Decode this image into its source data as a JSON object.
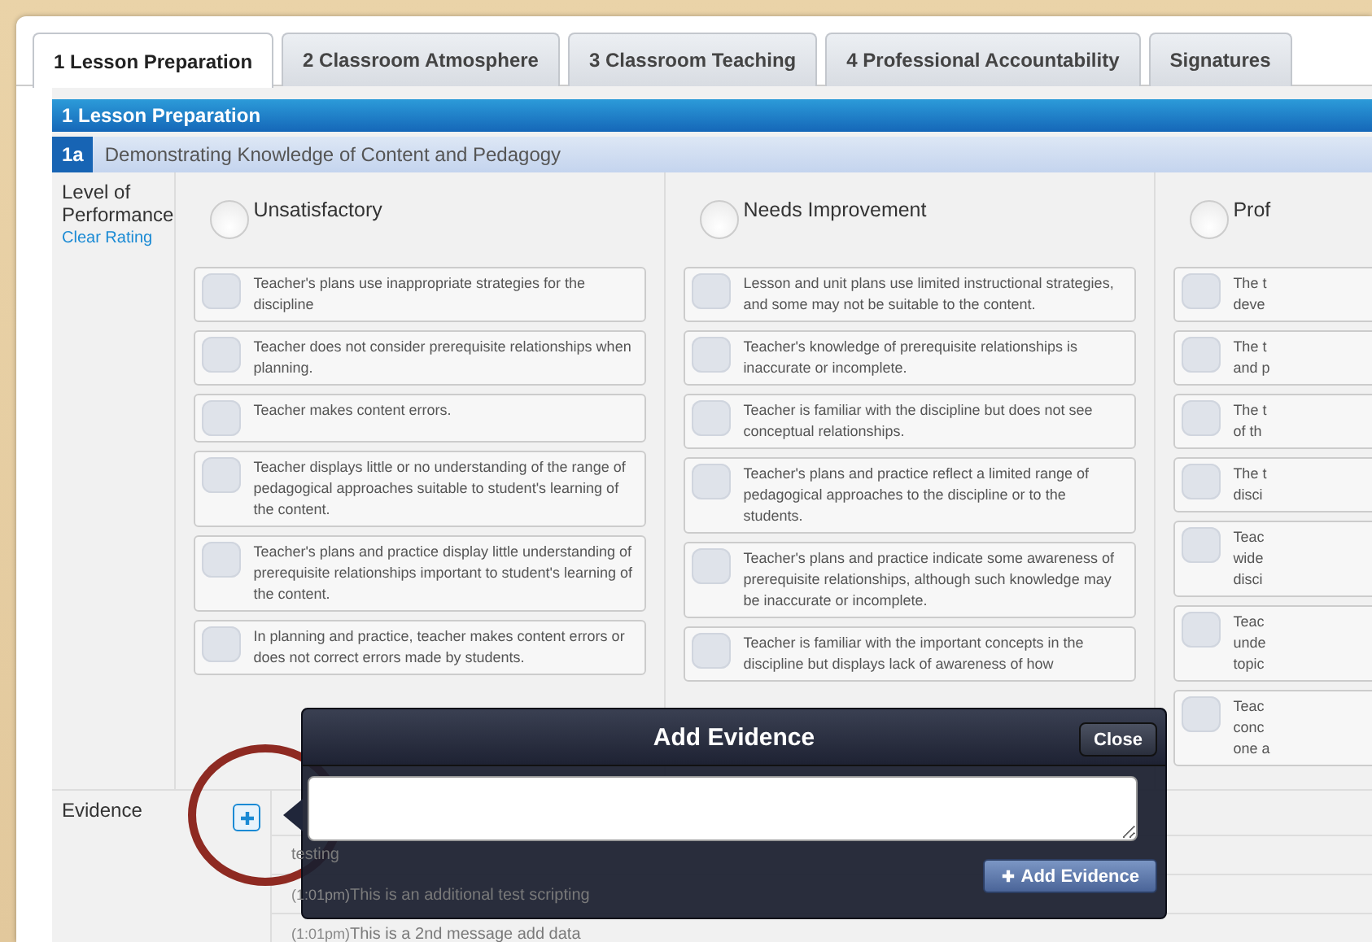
{
  "tabs": [
    {
      "label": "1 Lesson Preparation",
      "selected": true
    },
    {
      "label": "2 Classroom Atmosphere",
      "selected": false
    },
    {
      "label": "3 Classroom Teaching",
      "selected": false
    },
    {
      "label": "4 Professional Accountability",
      "selected": false
    },
    {
      "label": "Signatures",
      "selected": false
    }
  ],
  "section_header": "1 Lesson Preparation",
  "component": {
    "code": "1a",
    "title": "Demonstrating Knowledge of Content and Pedagogy"
  },
  "performance": {
    "label": "Level of Performance",
    "clear_link": "Clear Rating",
    "levels": [
      {
        "name": "Unsatisfactory",
        "selected": false,
        "items": [
          {
            "text": "Teacher's plans use inappropriate strategies for the discipline",
            "checked": false
          },
          {
            "text": "Teacher does not consider prerequisite relationships when planning.",
            "checked": false
          },
          {
            "text": "Teacher makes content errors.",
            "checked": false
          },
          {
            "text": "Teacher displays little or no understanding of the range of pedagogical approaches suitable to student's learning of the content.",
            "checked": false
          },
          {
            "text": "Teacher's plans and practice display little understanding of prerequisite relationships important to student's learning of the content.",
            "checked": false
          },
          {
            "text": "In planning and practice, teacher makes content errors or does not correct errors made by students.",
            "checked": false
          }
        ]
      },
      {
        "name": "Needs Improvement",
        "selected": false,
        "items": [
          {
            "text": "Lesson and unit plans use limited instructional strategies, and some may not be suitable to the content.",
            "checked": false
          },
          {
            "text": "Teacher's knowledge of prerequisite relationships is inaccurate or incomplete.",
            "checked": false
          },
          {
            "text": "Teacher is familiar with the discipline but does not see conceptual relationships.",
            "checked": false
          },
          {
            "text": "Teacher's plans and practice reflect a limited range of pedagogical approaches to the discipline or to the students.",
            "checked": false
          },
          {
            "text": "Teacher's plans and practice indicate some awareness of prerequisite relationships, although such knowledge may be inaccurate or incomplete.",
            "checked": false
          },
          {
            "text": "Teacher is familiar with the important concepts in the discipline but displays lack of awareness of how",
            "checked": false
          }
        ]
      },
      {
        "name": "Prof",
        "selected": false,
        "items": [
          {
            "text": "The t\ndeve",
            "checked": false
          },
          {
            "text": "The t\nand p",
            "checked": false
          },
          {
            "text": "The t\nof th",
            "checked": false
          },
          {
            "text": "The t\ndisci",
            "checked": false
          },
          {
            "text": "Teac\nwide\ndisci",
            "checked": false
          },
          {
            "text": "Teac\nunde\ntopic",
            "checked": false
          },
          {
            "text": "Teac\nconc\none a",
            "checked": false
          }
        ]
      }
    ]
  },
  "evidence": {
    "label": "Evidence",
    "entries": [
      {
        "text": "testing"
      },
      {
        "time": "(1:01pm)",
        "text": "This is an additional test scripting"
      },
      {
        "time": "(1:01pm)",
        "text": "This is a 2nd message add data"
      }
    ]
  },
  "popup": {
    "title": "Add Evidence",
    "close": "Close",
    "add_button": "Add Evidence"
  }
}
